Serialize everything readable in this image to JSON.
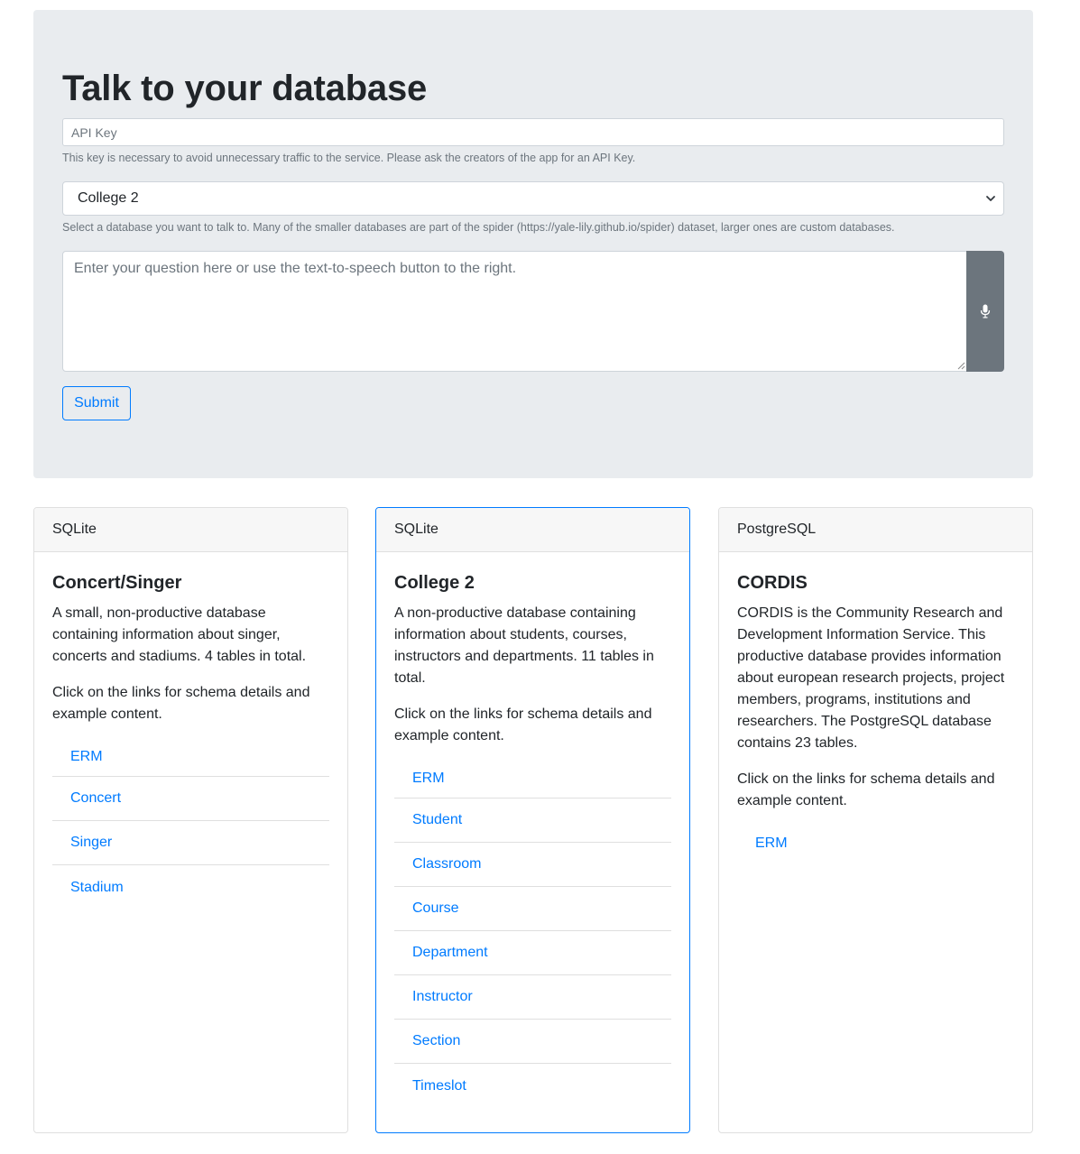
{
  "header": {
    "title": "Talk to your database"
  },
  "form": {
    "api_key": {
      "placeholder": "API Key",
      "value": "",
      "help": "This key is necessary to avoid unnecessary traffic to the service. Please ask the creators of the app for an API Key."
    },
    "database_select": {
      "selected": "College 2",
      "help": "Select a database you want to talk to. Many of the smaller databases are part of the spider (https://yale-lily.github.io/spider) dataset, larger ones are custom databases."
    },
    "question": {
      "placeholder": "Enter your question here or use the text-to-speech button to the right.",
      "value": ""
    },
    "mic_icon": "microphone-icon",
    "submit_label": "Submit"
  },
  "cards": [
    {
      "engine": "SQLite",
      "title": "Concert/Singer",
      "description": "A small, non-productive database containing information about singer, concerts and stadiums. 4 tables in total.",
      "instruction": "Click on the links for schema details and example content.",
      "active": false,
      "links": [
        "ERM",
        "Concert",
        "Singer",
        "Stadium"
      ]
    },
    {
      "engine": "SQLite",
      "title": "College 2",
      "description": "A non-productive database containing information about students, courses, instructors and departments. 11 tables in total.",
      "instruction": "Click on the links for schema details and example content.",
      "active": true,
      "links": [
        "ERM",
        "Student",
        "Classroom",
        "Course",
        "Department",
        "Instructor",
        "Section",
        "Timeslot"
      ]
    },
    {
      "engine": "PostgreSQL",
      "title": "CORDIS",
      "description": "CORDIS is the Community Research and Development Information Service. This productive database provides information about european research projects, project members, programs, institutions and researchers. The PostgreSQL database contains 23 tables.",
      "instruction": "Click on the links for schema details and example content.",
      "active": false,
      "links": [
        "ERM"
      ]
    }
  ],
  "colors": {
    "primary": "#007bff",
    "jumbotron_bg": "#e9ecef",
    "mic_bg": "#6c757d",
    "muted": "#6c757d"
  }
}
